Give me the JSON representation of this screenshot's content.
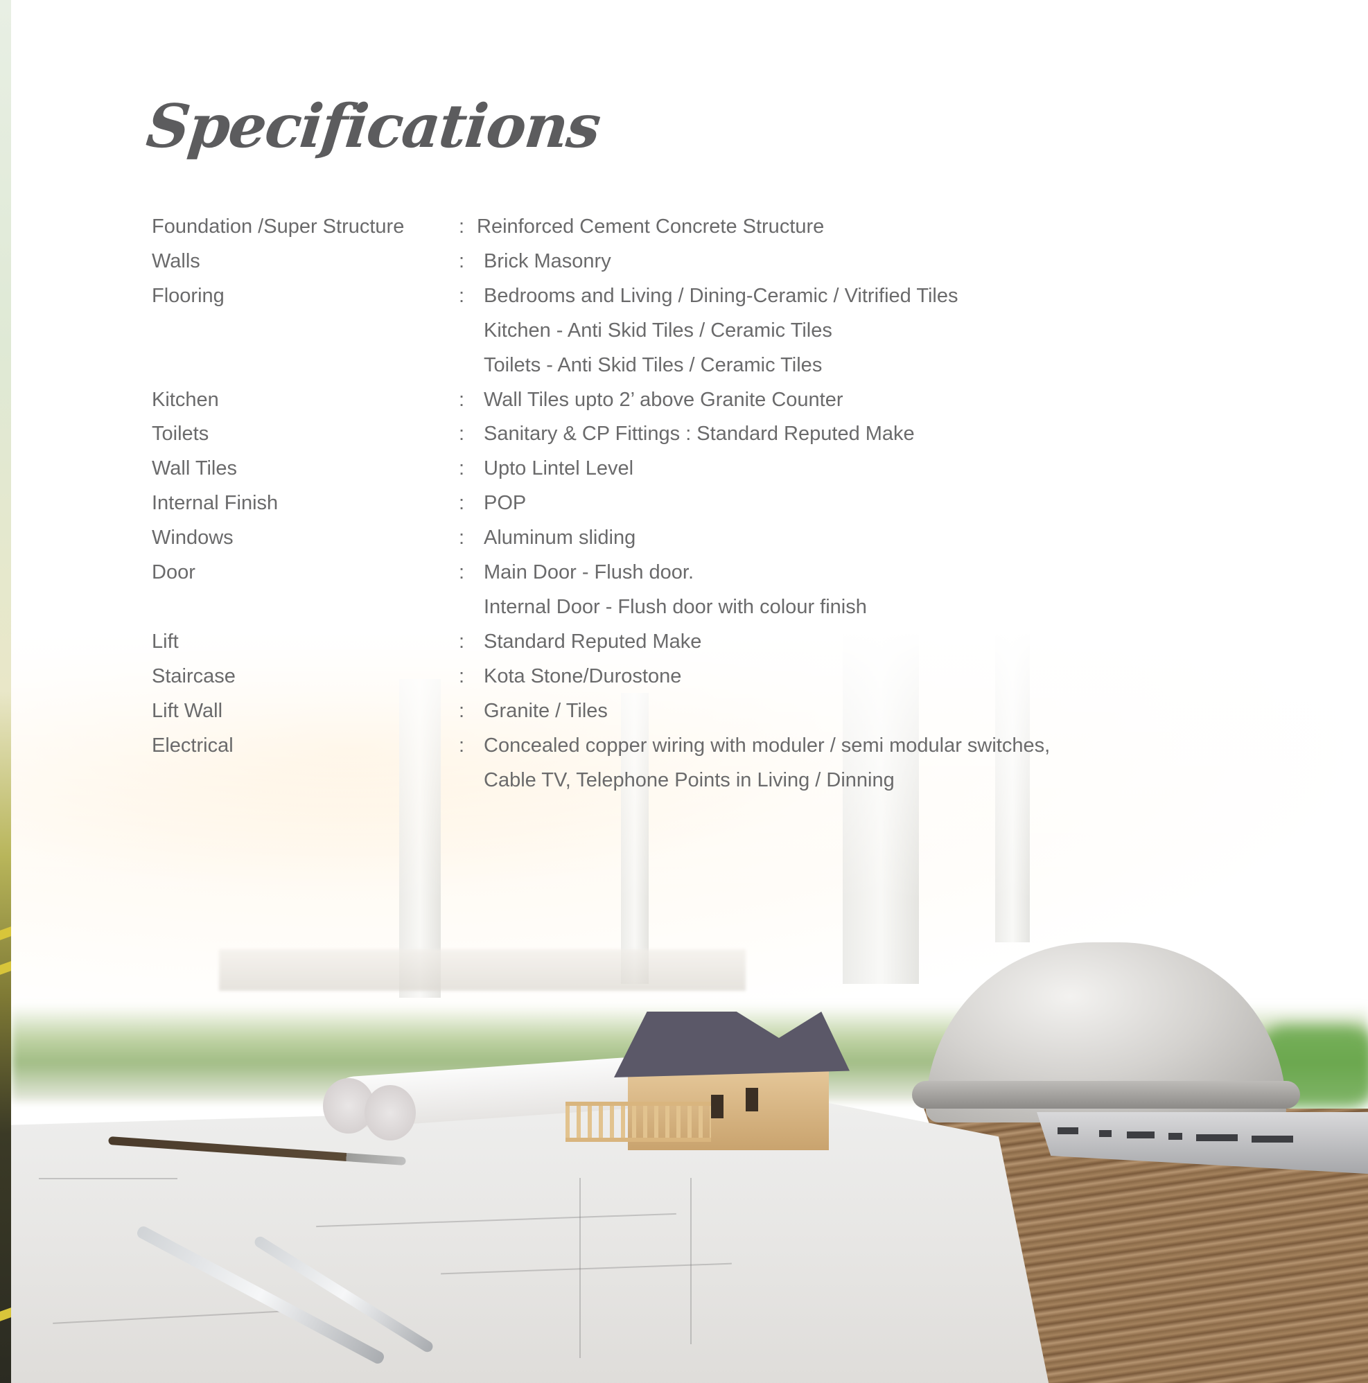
{
  "page": {
    "title": "Specifications"
  },
  "specs": [
    {
      "label": "Foundation /Super Structure",
      "separator": ":",
      "values": [
        "Reinforced Cement Concrete Structure"
      ]
    },
    {
      "label": "Walls",
      "separator": ":",
      "values": [
        "Brick Masonry"
      ]
    },
    {
      "label": "Flooring",
      "separator": ":",
      "values": [
        "Bedrooms and Living / Dining-Ceramic / Vitrified Tiles",
        "Kitchen - Anti Skid Tiles / Ceramic Tiles",
        "Toilets - Anti Skid Tiles / Ceramic Tiles"
      ]
    },
    {
      "label": "Kitchen",
      "separator": ":",
      "values": [
        "Wall Tiles upto 2’ above Granite Counter"
      ]
    },
    {
      "label": "Toilets",
      "separator": ":",
      "values": [
        "Sanitary & CP Fittings : Standard Reputed Make"
      ]
    },
    {
      "label": "Wall Tiles",
      "separator": ":",
      "values": [
        "Upto Lintel Level"
      ]
    },
    {
      "label": "Internal Finish",
      "separator": ":",
      "values": [
        "POP"
      ]
    },
    {
      "label": "Windows",
      "separator": ":",
      "values": [
        "Aluminum sliding"
      ]
    },
    {
      "label": "Door",
      "separator": ":",
      "values": [
        "Main Door - Flush door.",
        "Internal Door - Flush door with colour finish"
      ]
    },
    {
      "label": "Lift",
      "separator": ":",
      "values": [
        "Standard Reputed Make"
      ]
    },
    {
      "label": "Staircase",
      "separator": ":",
      "values": [
        "Kota Stone/Durostone"
      ]
    },
    {
      "label": "Lift Wall",
      "separator": ":",
      "values": [
        "Granite / Tiles"
      ]
    },
    {
      "label": "Electrical",
      "separator": ":",
      "values": [
        "Concealed copper wiring with moduler / semi modular switches,",
        "Cable TV, Telephone Points in Living / Dinning"
      ]
    }
  ],
  "colors": {
    "title": "#5c5c5e",
    "text": "#6a6a6b",
    "background": "#ffffff"
  }
}
